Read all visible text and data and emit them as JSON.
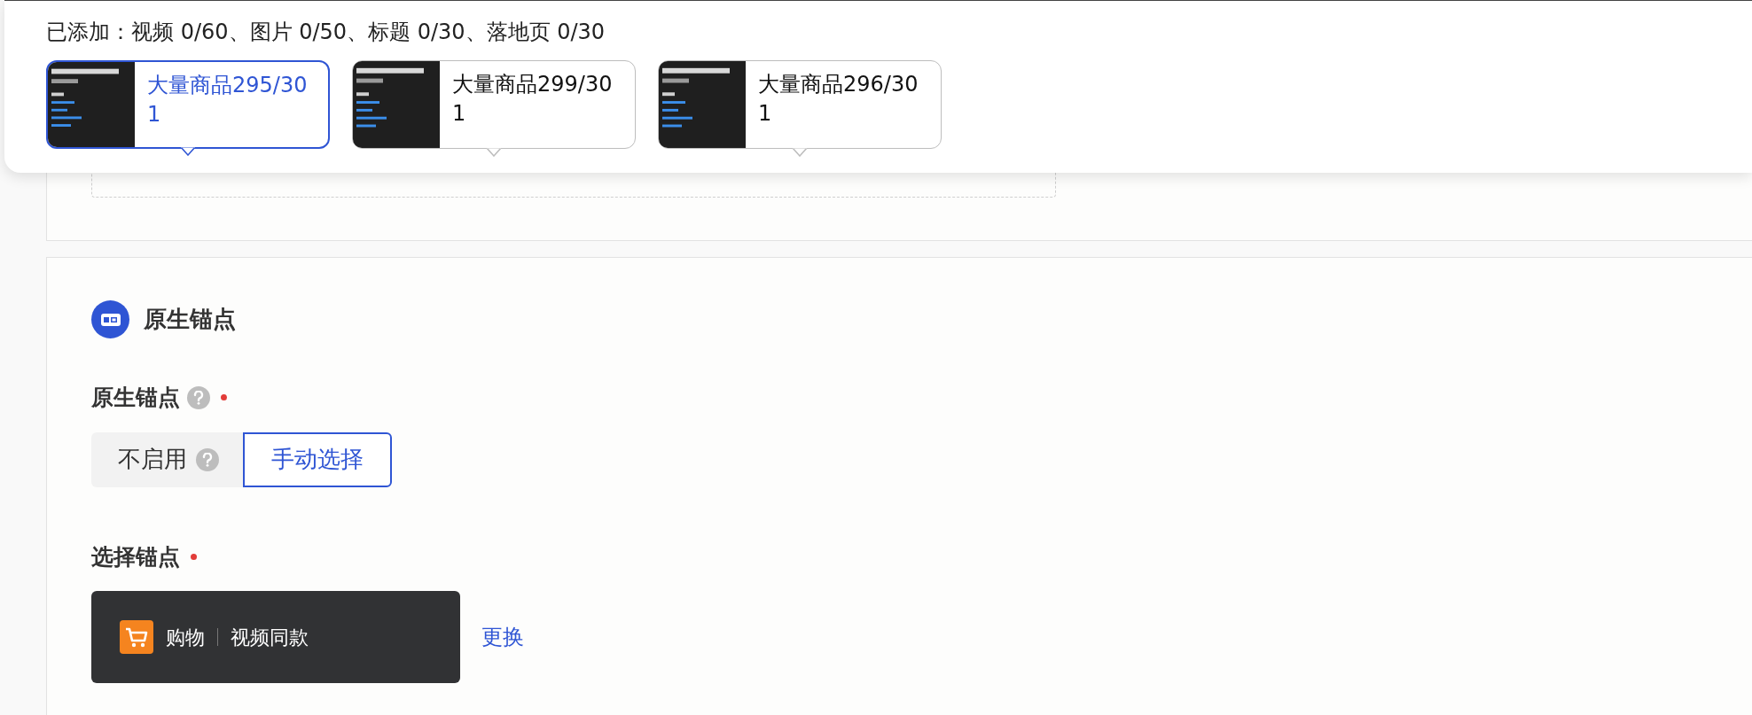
{
  "summary": "已添加：视频 0/60、图片 0/50、标题 0/30、落地页 0/30",
  "materials": [
    {
      "title": "大量商品295/301",
      "selected": true
    },
    {
      "title": "大量商品299/301",
      "selected": false
    },
    {
      "title": "大量商品296/301",
      "selected": false
    }
  ],
  "section": {
    "title": "原生锚点"
  },
  "fields": [
    {
      "kind": "segmented",
      "label": "原生锚点",
      "required": true,
      "help": true,
      "options": [
        {
          "label": "不启用",
          "help": true,
          "selected": false
        },
        {
          "label": "手动选择",
          "help": false,
          "selected": true
        }
      ]
    },
    {
      "kind": "anchor",
      "label": "选择锚点",
      "required": true,
      "help": false,
      "anchor": {
        "category": "购物",
        "name": "视频同款"
      },
      "action": "更换"
    }
  ]
}
